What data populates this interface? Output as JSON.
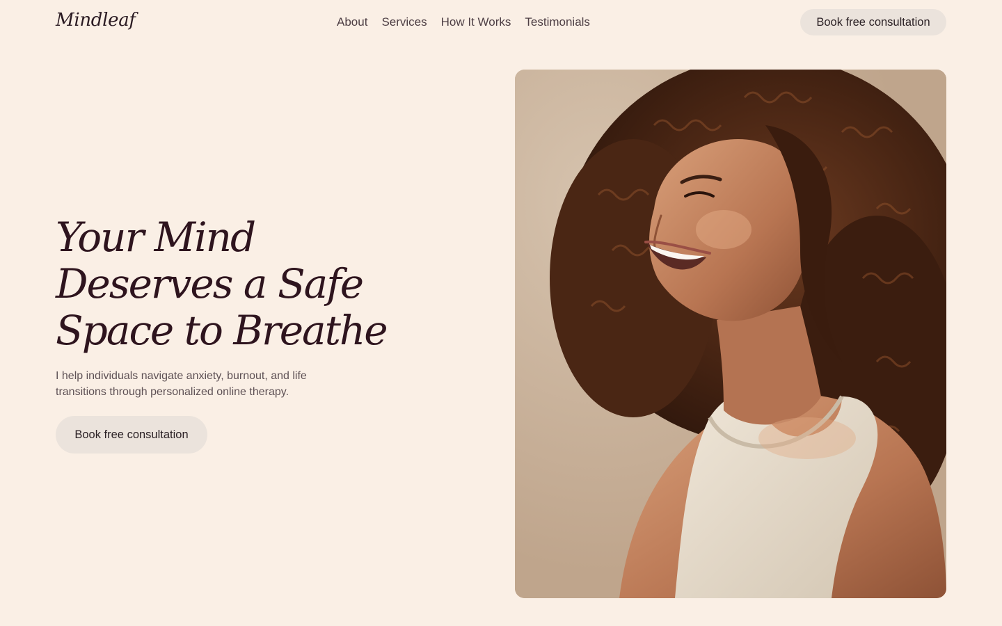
{
  "brand": {
    "logo": "Mindleaf"
  },
  "nav": {
    "items": [
      {
        "label": "About"
      },
      {
        "label": "Services"
      },
      {
        "label": "How It Works"
      },
      {
        "label": "Testimonials"
      }
    ]
  },
  "header": {
    "cta_label": "Book free consultation"
  },
  "hero": {
    "title_lines": [
      "Your Mind",
      "Deserves a Safe",
      "Space to Breathe"
    ],
    "subtitle": "I help individuals navigate anxiety, burnout, and life transitions through personalized online therapy.",
    "cta_label": "Book free consultation"
  },
  "colors": {
    "background": "#faefe5",
    "heading": "#2e141e",
    "button_bg": "#ebe3dc",
    "body_text": "#5e5155"
  }
}
